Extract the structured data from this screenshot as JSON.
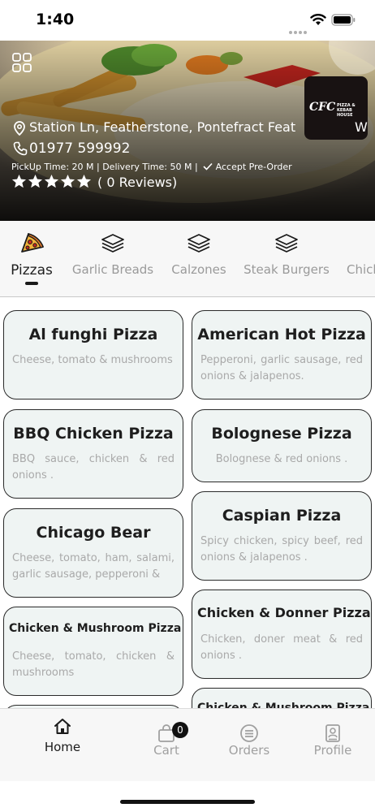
{
  "status_bar": {
    "time": "1:40"
  },
  "restaurant": {
    "logo_text": "CFC",
    "logo_sub": "PIZZA & KEBAB HOUSE",
    "address": "Station Ln, Featherstone, Pontefract Feat",
    "address_tail": "W",
    "phone": "01977 599992",
    "times": "PickUp Time: 20 M | Delivery Time: 50 M |",
    "pre_order": "Accept Pre-Order",
    "stars": 5,
    "reviews": "( 0 Reviews)"
  },
  "tabs": [
    {
      "label": "Pizzas",
      "icon": "pizza-slice-icon",
      "active": true
    },
    {
      "label": "Garlic Breads",
      "icon": "layers-icon",
      "active": false
    },
    {
      "label": "Calzones",
      "icon": "layers-icon",
      "active": false
    },
    {
      "label": "Steak Burgers",
      "icon": "layers-icon",
      "active": false
    },
    {
      "label": "Chick",
      "icon": "layers-icon",
      "active": false
    }
  ],
  "menu": {
    "left": [
      {
        "title": "Al funghi Pizza",
        "desc": "Cheese, tomato & mushrooms"
      },
      {
        "title": "BBQ Chicken Pizza",
        "desc": "BBQ sauce, chicken & red onions ."
      },
      {
        "title": "Chicago Bear",
        "desc": "Cheese, tomato, ham, salami, garlic sausage, pepperoni &"
      },
      {
        "title": "Chicken & Mushroom Pizza",
        "desc": "Cheese, tomato, chicken & mushrooms"
      }
    ],
    "right": [
      {
        "title": "American Hot Pizza",
        "desc": "Pepperoni, garlic sausage, red onions & jalapenos."
      },
      {
        "title": "Bolognese Pizza",
        "desc": "Bolognese & red onions ."
      },
      {
        "title": "Caspian Pizza",
        "desc": "Spicy chicken, spicy beef, red onions & jalapenos ."
      },
      {
        "title": "Chicken & Donner Pizza",
        "desc": "Chicken, doner meat & red onions ."
      },
      {
        "title": "Chicken & Mushroom Pizza",
        "desc": ""
      }
    ]
  },
  "bottom_nav": {
    "home": "Home",
    "cart": "Cart",
    "cart_count": "0",
    "orders": "Orders",
    "profile": "Profile"
  },
  "colors": {
    "card_bg": "#eff4f3",
    "accent": "#1a1a1a",
    "muted": "#a0a0a0"
  }
}
